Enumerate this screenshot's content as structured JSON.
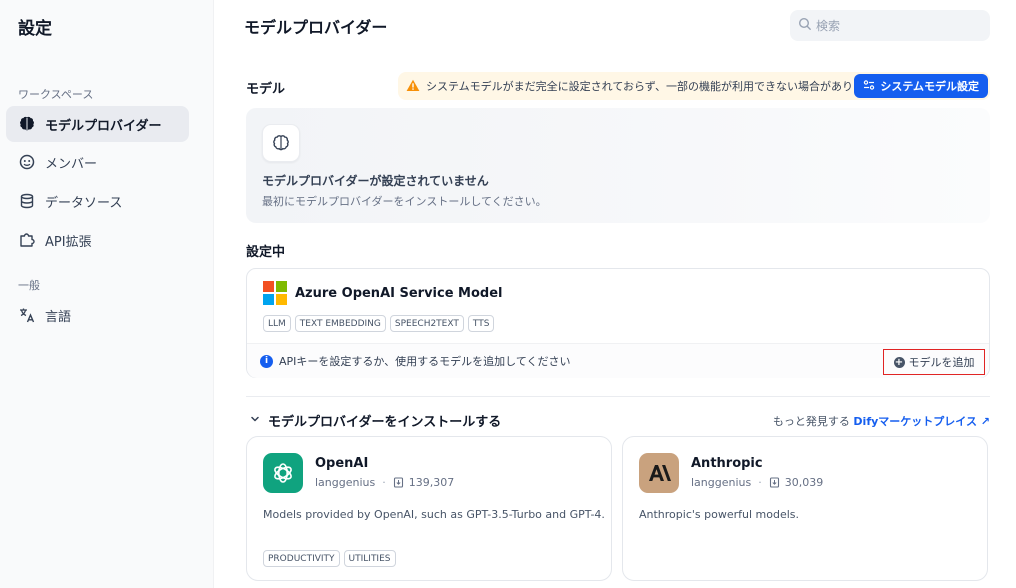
{
  "sidebar": {
    "title": "設定",
    "workspace_label": "ワークスペース",
    "items": [
      {
        "label": "モデルプロバイダー",
        "icon": "brain-icon"
      },
      {
        "label": "メンバー",
        "icon": "team-icon"
      },
      {
        "label": "データソース",
        "icon": "database-icon"
      },
      {
        "label": "API拡張",
        "icon": "puzzle-icon"
      }
    ],
    "general_label": "一般",
    "lang_item": {
      "label": "言語",
      "icon": "translate-icon"
    }
  },
  "header": {
    "title": "モデルプロバイダー",
    "search_placeholder": "検索"
  },
  "model_section": {
    "label": "モデル",
    "warning": "システムモデルがまだ完全に設定されておらず、一部の機能が利用できない場合があります。",
    "system_button": "システムモデル設定",
    "empty_title": "モデルプロバイダーが設定されていません",
    "empty_sub": "最初にモデルプロバイダーをインストールしてください。"
  },
  "configured": {
    "label": "設定中",
    "provider": {
      "name": "Azure OpenAI Service Model",
      "tags": [
        "LLM",
        "TEXT EMBEDDING",
        "SPEECH2TEXT",
        "TTS"
      ],
      "info": "APIキーを設定するか、使用するモデルを追加してください",
      "add_button": "モデルを追加"
    }
  },
  "install": {
    "label": "モデルプロバイダーをインストールする",
    "discover_text": "もっと発見する",
    "marketplace_link": "Difyマーケットプレイス ↗",
    "cards": [
      {
        "name": "OpenAI",
        "author": "langgenius",
        "downloads": "139,307",
        "description": "Models provided by OpenAI, such as GPT-3.5-Turbo and GPT-4.",
        "tags": [
          "PRODUCTIVITY",
          "UTILITIES"
        ],
        "logo_color": "#10a37f"
      },
      {
        "name": "Anthropic",
        "author": "langgenius",
        "downloads": "30,039",
        "description": "Anthropic's powerful models.",
        "tags": [],
        "logo_color": "#c9a27e"
      }
    ]
  },
  "colors": {
    "accent": "#155eef",
    "warning_bg": "#fff7e6",
    "warning_icon": "#f79009",
    "highlight_border": "#e02424"
  }
}
